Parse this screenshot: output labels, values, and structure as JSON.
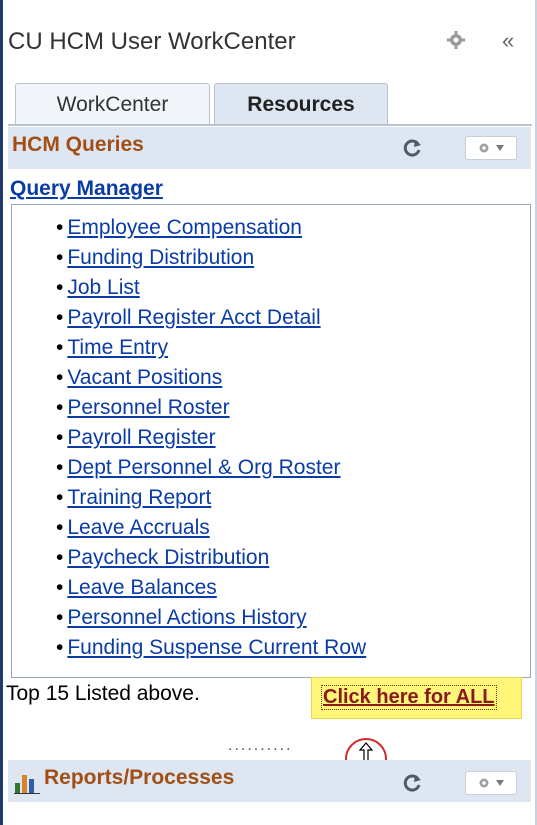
{
  "header": {
    "title": "CU HCM User WorkCenter",
    "collapse_label": "«"
  },
  "tabs": [
    {
      "label": "WorkCenter",
      "active": false
    },
    {
      "label": "Resources",
      "active": true
    }
  ],
  "hcm_queries": {
    "title": "HCM Queries",
    "query_manager": "Query Manager",
    "items": [
      "Employee Compensation",
      "Funding Distribution",
      "Job List",
      "Payroll Register Acct Detail",
      "Time Entry",
      "Vacant Positions",
      "Personnel Roster",
      "Payroll Register",
      "Dept Personnel & Org Roster",
      "Training Report",
      "Leave Accruals",
      "Paycheck Distribution",
      "Leave Balances",
      "Personnel Actions History",
      "Funding Suspense Current Row"
    ],
    "bullet": "•",
    "footer_text": "Top 15 Listed above.",
    "all_link": "Click here for ALL"
  },
  "divider_dots": "..........",
  "reports": {
    "title": "Reports/Processes"
  },
  "colors": {
    "section_title": "#a24e15",
    "link": "#0a3ca8",
    "highlight": "#fff67a",
    "section_bg": "#dde6f1",
    "cursor_ring": "#d12a2a"
  },
  "icons": [
    "gear-icon",
    "collapse-icon",
    "refresh-icon",
    "gear-dropdown-icon",
    "bar-chart-icon",
    "resize-cursor-icon"
  ]
}
